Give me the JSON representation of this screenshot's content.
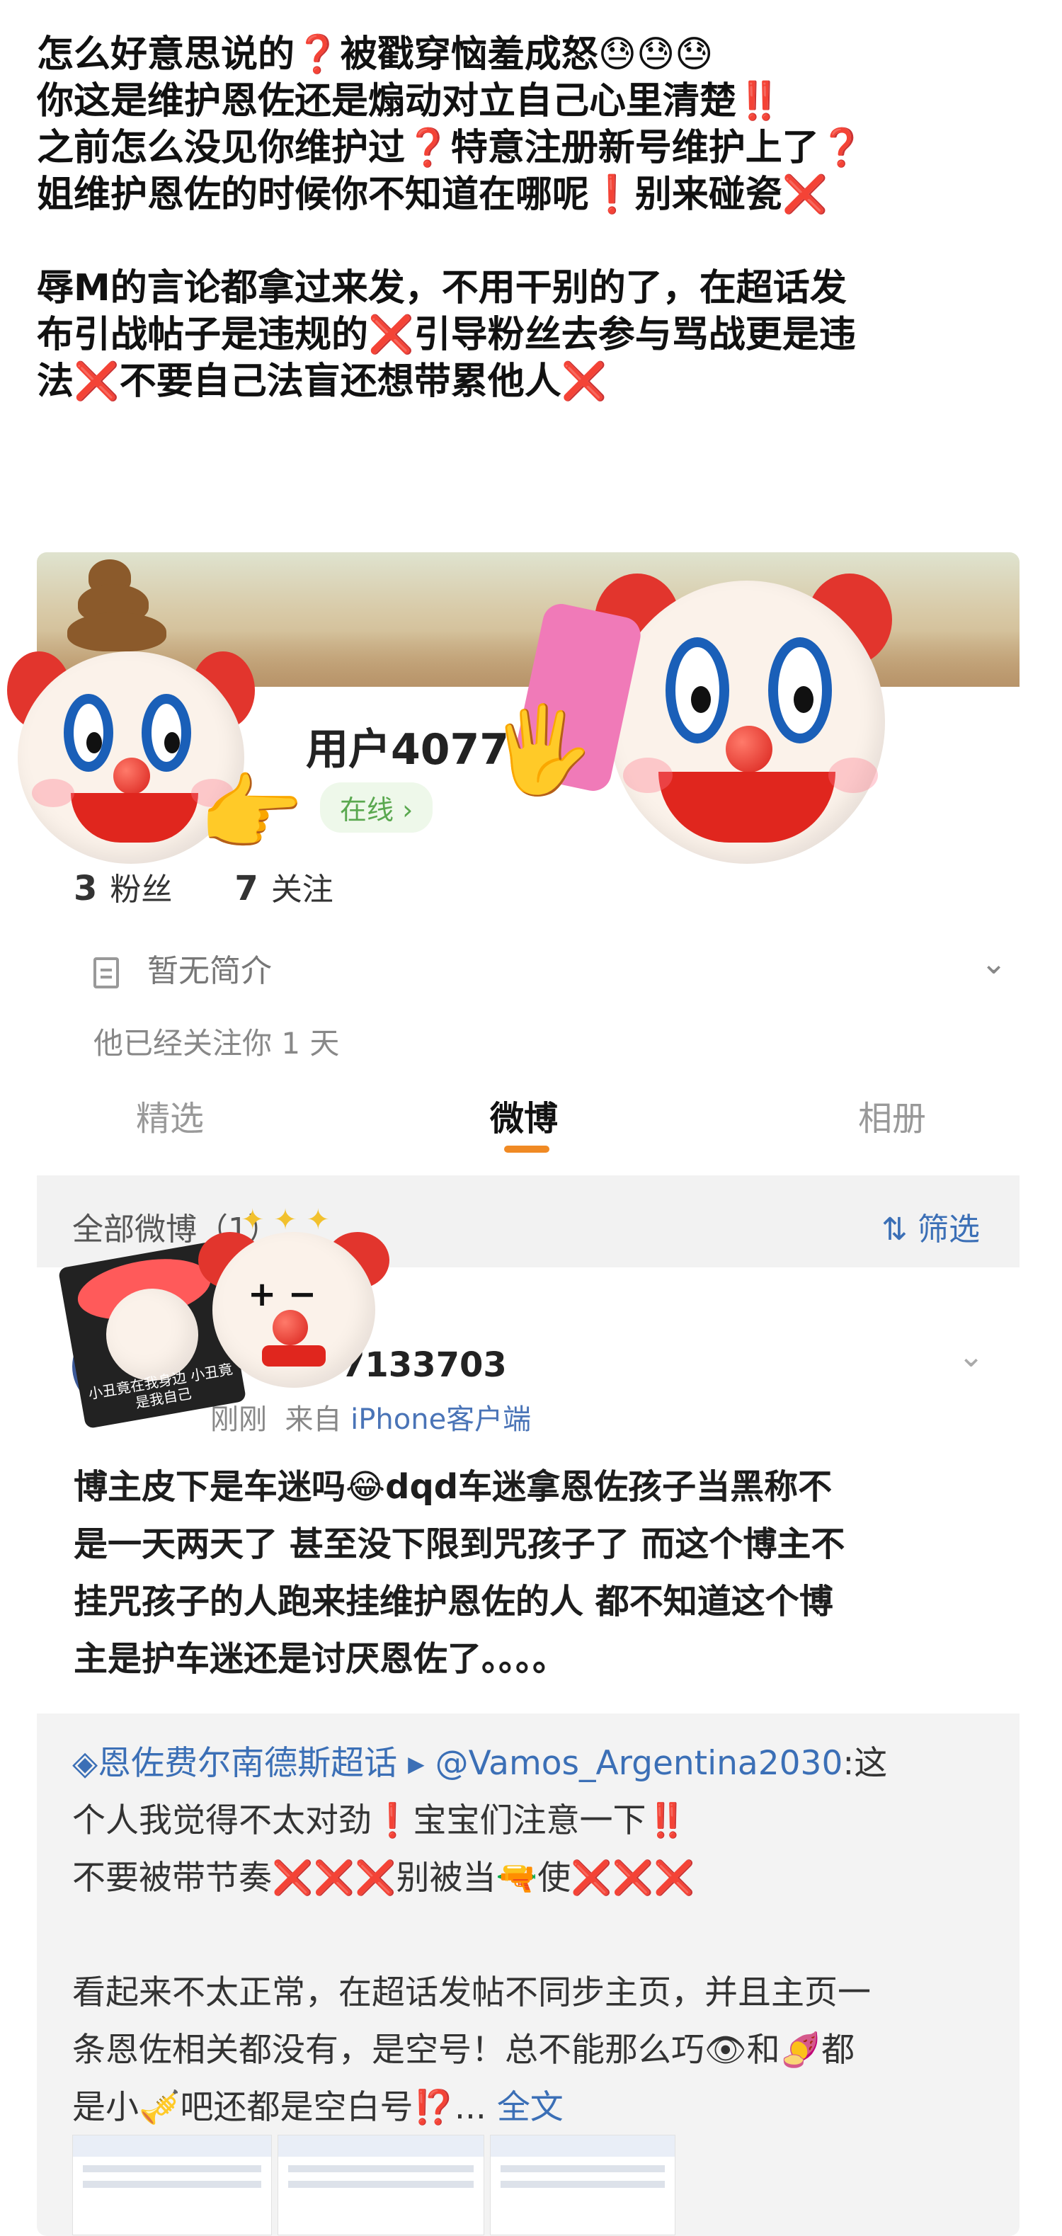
{
  "intro": {
    "lines": [
      "怎么好意思说的❓被戳穿恼羞成怒😓😓😓",
      "你这是维护恩佐还是煽动对立自己心里清楚‼️",
      "之前怎么没见你维护过❓特意注册新号维护上了❓",
      "姐维护恩佐的时候你不知道在哪呢❗别来碰瓷❌",
      "辱M的言论都拿过来发，不用干别的了，在超话发",
      "布引战帖子是违规的❌引导粉丝去参与骂战更是违",
      "法❌不要自己法盲还想带累他人❌"
    ]
  },
  "profile": {
    "username": "用户4077",
    "online_label": "在线 ›",
    "fans_count": "3",
    "fans_label": "粉丝",
    "following_count": "7",
    "following_label": "关注",
    "bio": "暂无简介",
    "follow_note": "他已经关注你 1 天"
  },
  "tabs": {
    "featured": "精选",
    "weibo": "微博",
    "album": "相册"
  },
  "filterbar": {
    "all_label": "全部微博（1）",
    "filter_label": "筛选"
  },
  "post": {
    "name": "7133703",
    "time": "刚刚",
    "from_prefix": "来自",
    "source": "iPhone客户端",
    "text_lines": [
      "博主皮下是车迷吗😂dqd车迷拿恩佐孩子当黑称不",
      "是一天两天了 甚至没下限到咒孩子了 而这个博主不",
      "挂咒孩子的人跑来挂维护恩佐的人 都不知道这个博",
      "主是护车迷还是讨厌恩佐了。。。。"
    ]
  },
  "repost": {
    "topic": "恩佐费尔南德斯超话",
    "mention": "@Vamos_Argentina2030",
    "line1_rest": ":这",
    "line2": "个人我觉得不太对劲❗宝宝们注意一下‼️",
    "line3": "不要被带节奏❌❌❌别被当🔫使❌❌❌",
    "line4": "看起来不太正常，在超话发帖不同步主页，并且主页一",
    "line5": "条恩佐相关都没有，是空号！总不能那么巧👁和🍠都",
    "line6_prefix": "是小🎺吧还都是空白号⁉️... ",
    "fulltext": "全文"
  },
  "sticker_captions": {
    "small_clown": "小丑竟在我身边 小丑竟是我自己"
  },
  "colors": {
    "accent_orange": "#f08a24",
    "link_blue": "#3b6fb6",
    "online_green": "#5aa84f",
    "warn_red": "#e0261e"
  }
}
